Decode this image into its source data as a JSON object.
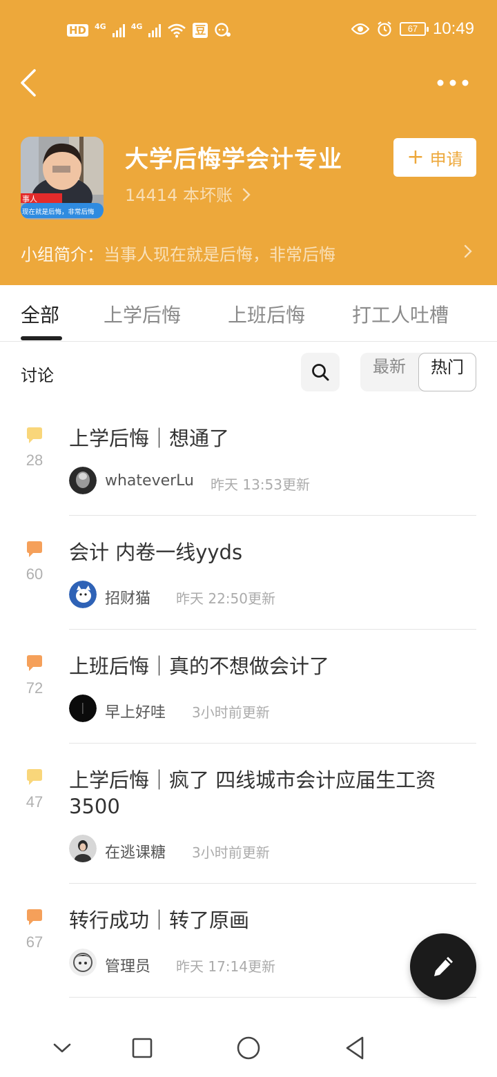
{
  "status_bar": {
    "hd": "HD",
    "sim1": "4G",
    "sim2": "4G",
    "douban_icon": "豆",
    "battery": "67",
    "time": "10:49"
  },
  "header": {
    "back_icon": "chevron-left-icon",
    "more_icon": "more-horizontal-icon",
    "avatar_caption_top": "事人",
    "avatar_caption_bottom": "现在就是后悔，非常后悔",
    "title": "大学后悔学会计专业",
    "subtitle": "14414 本坏账",
    "apply_plus": "+",
    "apply_label": "申请",
    "intro_label": "小组简介：",
    "intro_text": "当事人现在就是后悔，非常后悔"
  },
  "tabs": [
    "全部",
    "上学后悔",
    "上班后悔",
    "打工人吐槽"
  ],
  "toolbar": {
    "section": "讨论",
    "sort_latest": "最新",
    "sort_hot": "热门"
  },
  "posts": [
    {
      "count": "28",
      "title": "上学后悔｜想通了",
      "author": "whateverLu",
      "updated": "昨天 13:53更新",
      "icon_color": "#F9D67A"
    },
    {
      "count": "60",
      "title": "会计 内卷一线yyds",
      "author": "招财猫",
      "updated": "昨天 22:50更新",
      "icon_color": "#F5A05A"
    },
    {
      "count": "72",
      "title": "上班后悔｜真的不想做会计了",
      "author": "早上好哇",
      "updated": "3小时前更新",
      "icon_color": "#F5A05A"
    },
    {
      "count": "47",
      "title": "上学后悔｜疯了 四线城市会计应届生工资3500",
      "author": "在逃课糖",
      "updated": "3小时前更新",
      "icon_color": "#F9D67A"
    },
    {
      "count": "67",
      "title": "转行成功｜转了原画",
      "author": "管理员",
      "updated": "昨天 17:14更新",
      "icon_color": "#F5A05A"
    }
  ],
  "colors": {
    "header_bg": "#EDA83B",
    "fab_bg": "#1B1B1B"
  }
}
